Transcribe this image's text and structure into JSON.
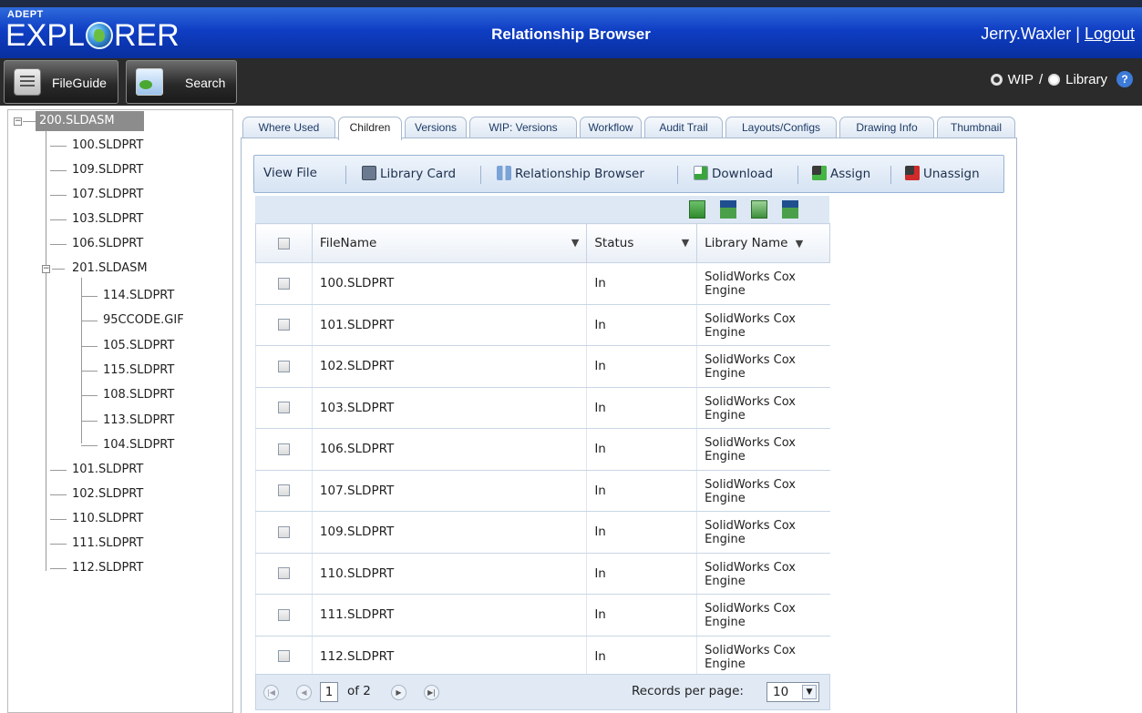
{
  "header": {
    "logo_small": "ADEPT",
    "logo_pre": "EXPL",
    "logo_post": "RER",
    "title": "Relationship Browser",
    "user": "Jerry.Waxler",
    "separator": "|",
    "logout": "Logout"
  },
  "toolbar": {
    "fileguide_label": "FileGuide",
    "search_label": "Search",
    "wip_label": "WIP",
    "slash": "/",
    "library_label": "Library",
    "help": "?"
  },
  "tree": {
    "root": "200.SLDASM",
    "children": [
      "100.SLDPRT",
      "109.SLDPRT",
      "107.SLDPRT",
      "103.SLDPRT",
      "106.SLDPRT"
    ],
    "sub_assembly": "201.SLDASM",
    "sub_children": [
      "114.SLDPRT",
      "95CCODE.GIF",
      "105.SLDPRT",
      "115.SLDPRT",
      "108.SLDPRT",
      "113.SLDPRT",
      "104.SLDPRT"
    ],
    "after": [
      "101.SLDPRT",
      "102.SLDPRT",
      "110.SLDPRT",
      "111.SLDPRT",
      "112.SLDPRT"
    ]
  },
  "tabs": [
    "Where Used",
    "Children",
    "Versions",
    "WIP: Versions",
    "Workflow",
    "Audit Trail",
    "Layouts/Configs",
    "Drawing Info",
    "Thumbnail"
  ],
  "actions": {
    "view_file": "View File",
    "library_card": "Library Card",
    "relationship_browser": "Relationship Browser",
    "download": "Download",
    "assign": "Assign",
    "unassign": "Unassign"
  },
  "grid": {
    "headers": {
      "filename": "FileName",
      "status": "Status",
      "library": "Library Name"
    },
    "rows": [
      {
        "file": "100.SLDPRT",
        "status": "In",
        "lib1": "SolidWorks Cox",
        "lib2": "Engine"
      },
      {
        "file": "101.SLDPRT",
        "status": "In",
        "lib1": "SolidWorks Cox",
        "lib2": "Engine"
      },
      {
        "file": "102.SLDPRT",
        "status": "In",
        "lib1": "SolidWorks Cox",
        "lib2": "Engine"
      },
      {
        "file": "103.SLDPRT",
        "status": "In",
        "lib1": "SolidWorks Cox",
        "lib2": "Engine"
      },
      {
        "file": "106.SLDPRT",
        "status": "In",
        "lib1": "SolidWorks Cox",
        "lib2": "Engine"
      },
      {
        "file": "107.SLDPRT",
        "status": "In",
        "lib1": "SolidWorks Cox",
        "lib2": "Engine"
      },
      {
        "file": "109.SLDPRT",
        "status": "In",
        "lib1": "SolidWorks Cox",
        "lib2": "Engine"
      },
      {
        "file": "110.SLDPRT",
        "status": "In",
        "lib1": "SolidWorks Cox",
        "lib2": "Engine"
      },
      {
        "file": "111.SLDPRT",
        "status": "In",
        "lib1": "SolidWorks Cox",
        "lib2": "Engine"
      },
      {
        "file": "112.SLDPRT",
        "status": "In",
        "lib1": "SolidWorks Cox",
        "lib2": "Engine"
      }
    ]
  },
  "pager": {
    "page": "1",
    "of_total": "of 2",
    "records_label": "Records per page:",
    "per_page": "10"
  },
  "colors": {
    "header_blue": "#0f3ec4",
    "tab_border": "#a6b8d0",
    "grid_header": "#e9eff7",
    "link_text": "#1d2f4d"
  }
}
